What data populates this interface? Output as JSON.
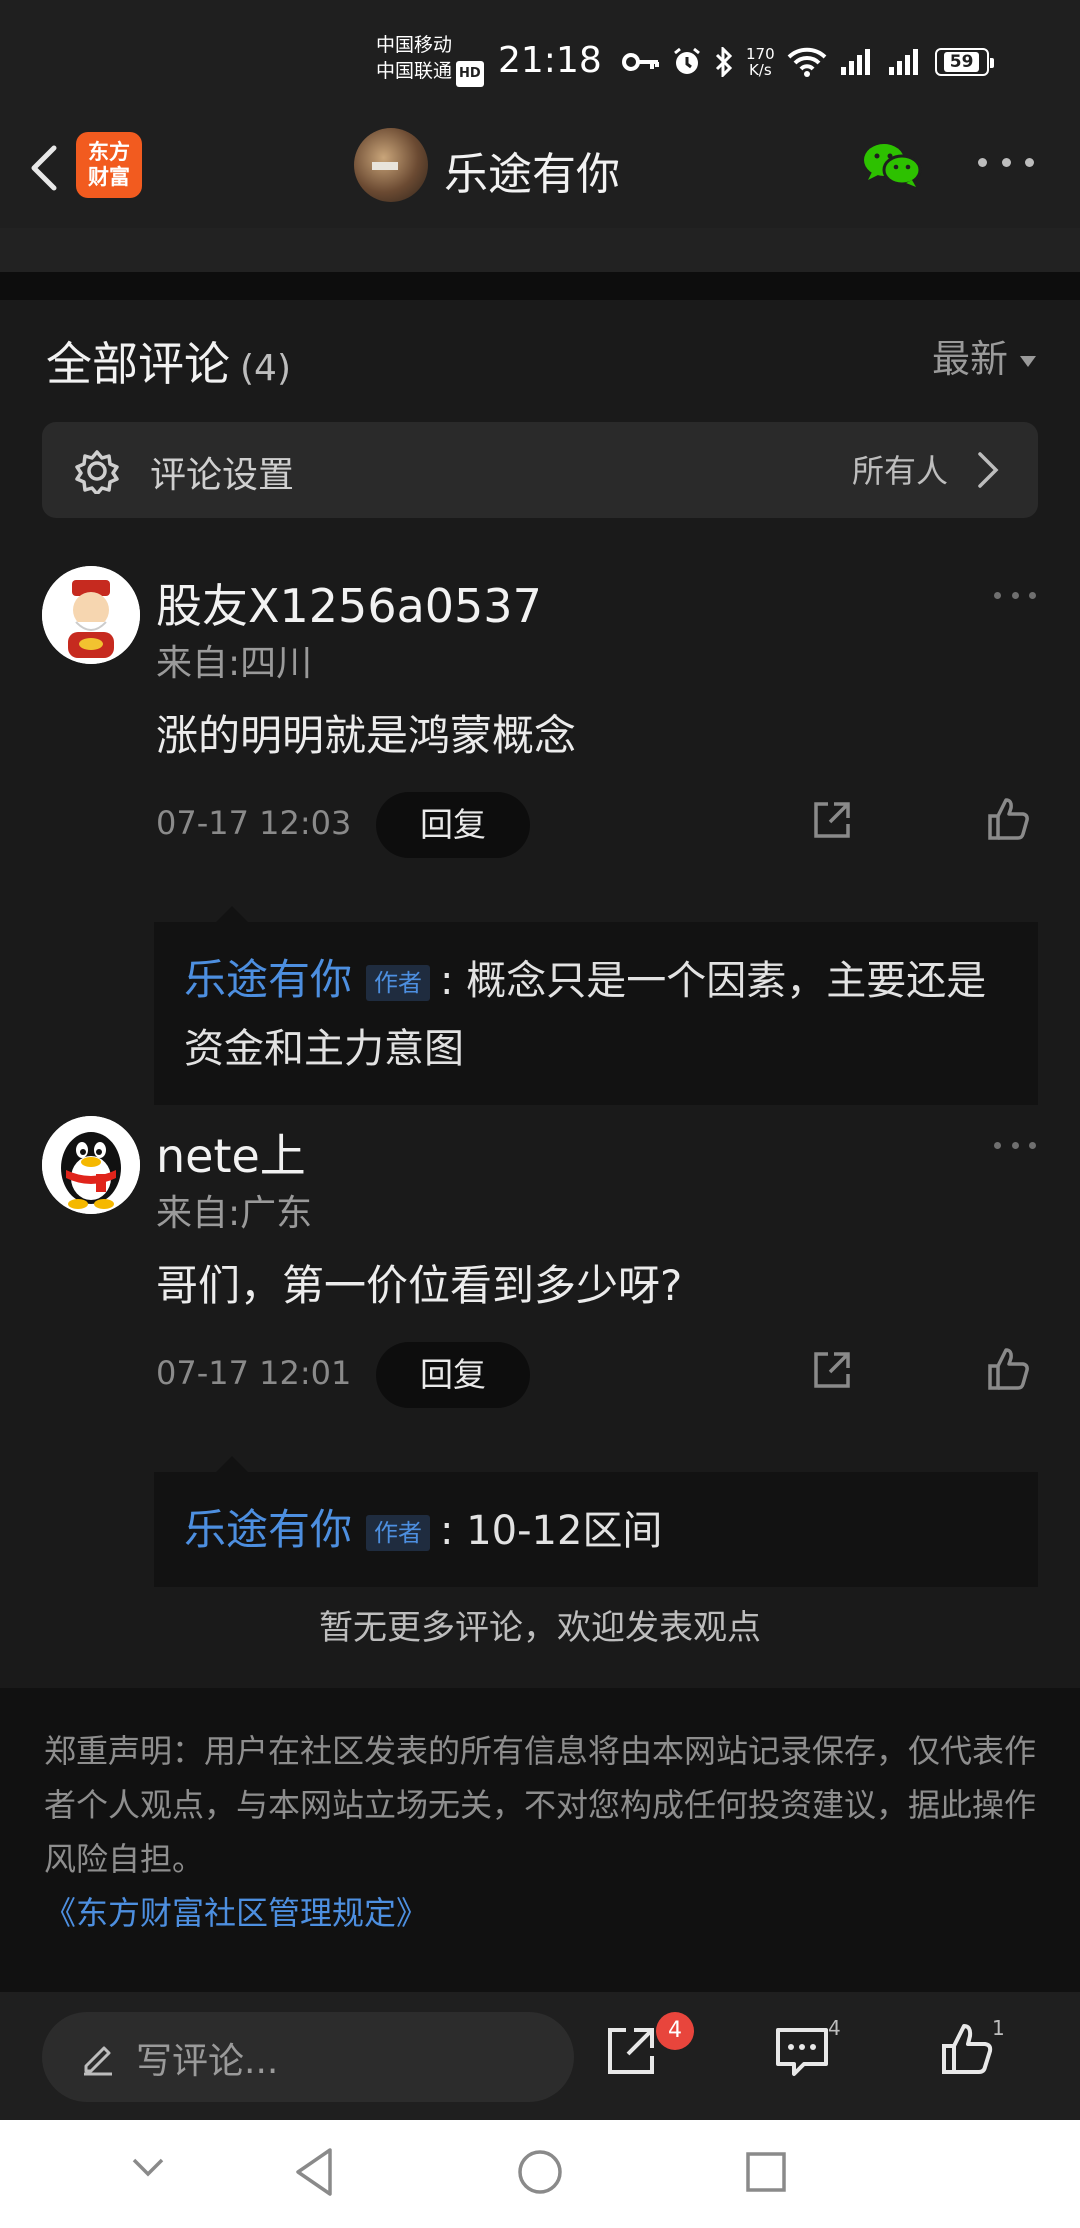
{
  "status_bar": {
    "carrier_1": "中国移动",
    "carrier_2": "中国联通",
    "hd": "HD",
    "time": "21:18",
    "net_speed_value": "170",
    "net_speed_unit": "K/s",
    "battery": "59"
  },
  "header": {
    "app_logo_line1": "东方",
    "app_logo_line2": "财富",
    "title": "乐途有你"
  },
  "comments_section": {
    "title": "全部评论",
    "count": "(4)",
    "sort": "最新",
    "setting_label": "评论设置",
    "setting_value": "所有人"
  },
  "comments": [
    {
      "user": "股友X1256a0537",
      "location": "来自:四川",
      "text": "涨的明明就是鸿蒙概念",
      "time": "07-17 12:03",
      "reply_label": "回复",
      "reply": {
        "author": "乐途有你",
        "tag": "作者",
        "text": ": 概念只是一个因素，主要还是资金和主力意图"
      }
    },
    {
      "user": "nete上",
      "location": "来自:广东",
      "text": "哥们，第一价位看到多少呀?",
      "time": "07-17 12:01",
      "reply_label": "回复",
      "reply": {
        "author": "乐途有你",
        "tag": "作者",
        "text": ": 10-12区间"
      }
    }
  ],
  "no_more": "暂无更多评论，欢迎发表观点",
  "disclaimer": {
    "text": "郑重声明：用户在社区发表的所有信息将由本网站记录保存，仅代表作者个人观点，与本网站立场无关，不对您构成任何投资建议，据此操作风险自担。",
    "rules_link": "《东方财富社区管理规定》"
  },
  "bottom_bar": {
    "write_placeholder": "写评论...",
    "share_badge": "4",
    "comment_count": "4",
    "like_count": "1"
  },
  "colors": {
    "background": "#1a1a1a",
    "accent_blue": "#4d8fe0",
    "badge_red": "#e8453c",
    "brand_orange": "#f25b1f",
    "wechat_green": "#2dc100"
  }
}
